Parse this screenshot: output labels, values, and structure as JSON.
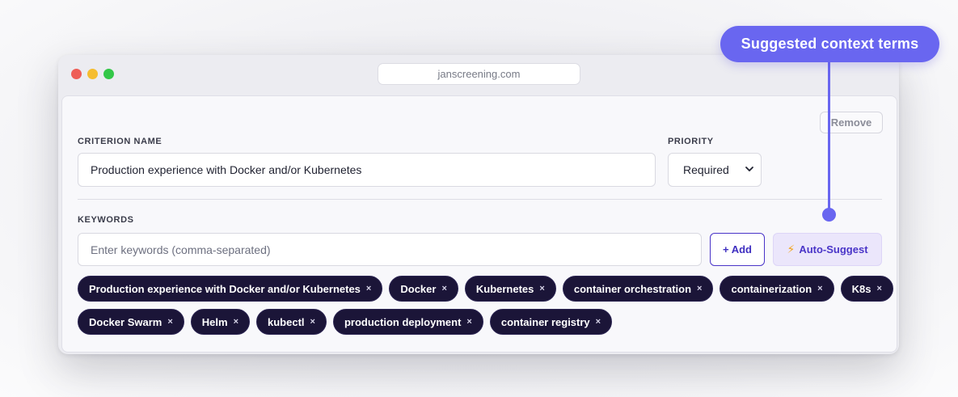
{
  "browser": {
    "url": "janscreening.com"
  },
  "form": {
    "remove_label": "Remove",
    "criterion_label": "CRITERION NAME",
    "criterion_value": "Production experience with Docker and/or Kubernetes",
    "priority_label": "PRIORITY",
    "priority_value": "Required",
    "keywords_label": "KEYWORDS",
    "keywords_placeholder": "Enter keywords (comma-separated)",
    "add_label": "+ Add",
    "suggest_label": "Auto-Suggest",
    "remove_chip_glyph": "×"
  },
  "keywords": [
    "Production experience with Docker and/or Kubernetes",
    "Docker",
    "Kubernetes",
    "container orchestration",
    "containerization",
    "K8s",
    "Docker Swarm",
    "Helm",
    "kubectl",
    "production deployment",
    "container registry"
  ],
  "callout": {
    "text": "Suggested context terms"
  },
  "colors": {
    "accent": "#6966f0",
    "chip_bg": "#1b1538",
    "primary": "#4a35c8",
    "suggest_bg": "#ebe6fb"
  }
}
